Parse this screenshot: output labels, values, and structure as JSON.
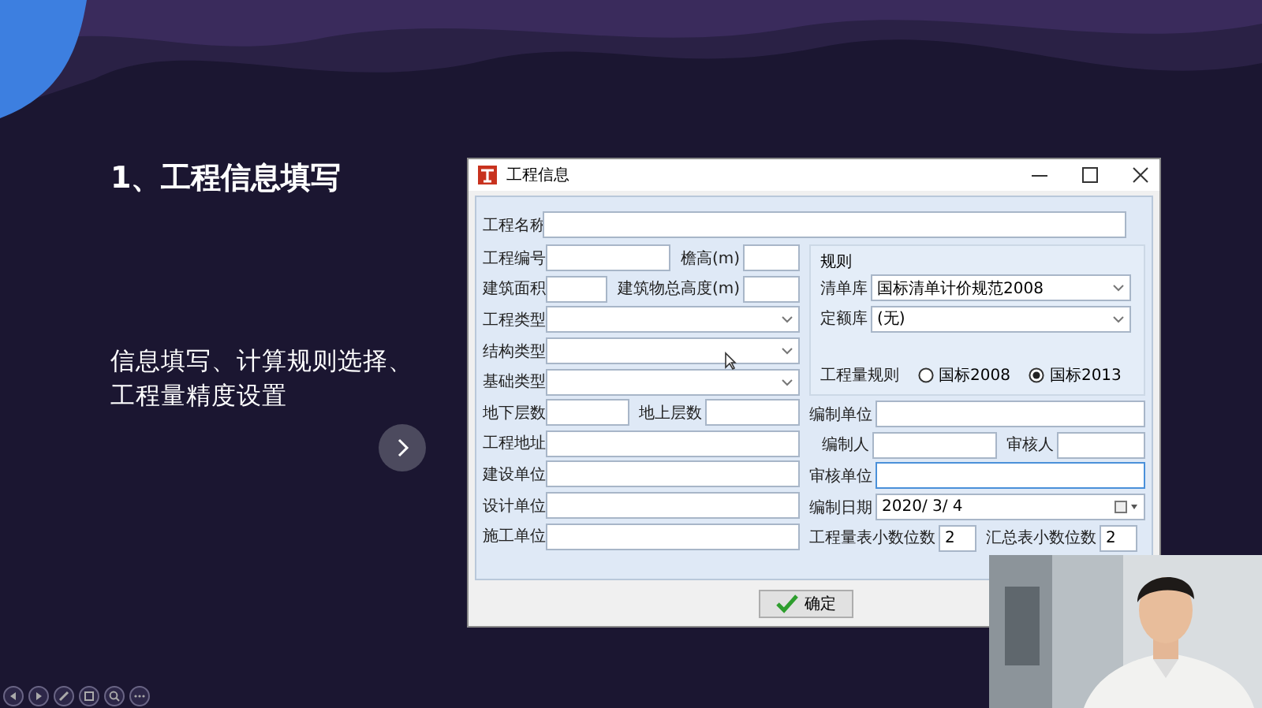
{
  "slide": {
    "title": "1、工程信息填写",
    "body": "信息填写、计算规则选择、工程量精度设置"
  },
  "dialog": {
    "title": "工程信息",
    "name_field": {
      "label": "工程名称"
    },
    "left_rows": [
      [
        {
          "label": "工程编号",
          "kind": "text"
        },
        {
          "label": "檐高(m)",
          "kind": "text"
        }
      ],
      [
        {
          "label": "建筑面积",
          "kind": "text"
        },
        {
          "label": "建筑物总高度(m)",
          "kind": "text"
        }
      ],
      [
        {
          "label": "工程类型",
          "kind": "dropdown"
        }
      ],
      [
        {
          "label": "结构类型",
          "kind": "dropdown"
        }
      ],
      [
        {
          "label": "基础类型",
          "kind": "dropdown"
        }
      ],
      [
        {
          "label": "地下层数",
          "kind": "text"
        },
        {
          "label": "地上层数",
          "kind": "text"
        }
      ],
      [
        {
          "label": "工程地址",
          "kind": "text"
        }
      ],
      [
        {
          "label": "建设单位",
          "kind": "text"
        }
      ],
      [
        {
          "label": "设计单位",
          "kind": "text"
        }
      ],
      [
        {
          "label": "施工单位",
          "kind": "text"
        }
      ]
    ],
    "rules": {
      "title": "规则",
      "libraries": [
        {
          "label": "清单库",
          "value": "国标清单计价规范2008"
        },
        {
          "label": "定额库",
          "value": "(无)"
        }
      ],
      "quantity_rule": {
        "label": "工程量规则",
        "options": [
          {
            "label": "国标2008",
            "selected": false
          },
          {
            "label": "国标2013",
            "selected": true
          }
        ]
      }
    },
    "right_rows": [
      [
        {
          "label": "编制单位",
          "kind": "text",
          "focused": false
        }
      ],
      [
        {
          "label": "编制人",
          "kind": "text",
          "focused": false
        },
        {
          "label": "审核人",
          "kind": "text",
          "focused": false
        }
      ],
      [
        {
          "label": "审核单位",
          "kind": "text",
          "focused": true
        }
      ],
      [
        {
          "label": "编制日期",
          "kind": "date",
          "value": "2020/  3/  4",
          "focused": false
        }
      ],
      [
        {
          "label": "工程量表小数位数",
          "kind": "text",
          "value": "2",
          "focused": false
        },
        {
          "label": "汇总表小数位数",
          "kind": "text",
          "value": "2",
          "focused": false
        }
      ]
    ],
    "ok_button": "确定"
  }
}
